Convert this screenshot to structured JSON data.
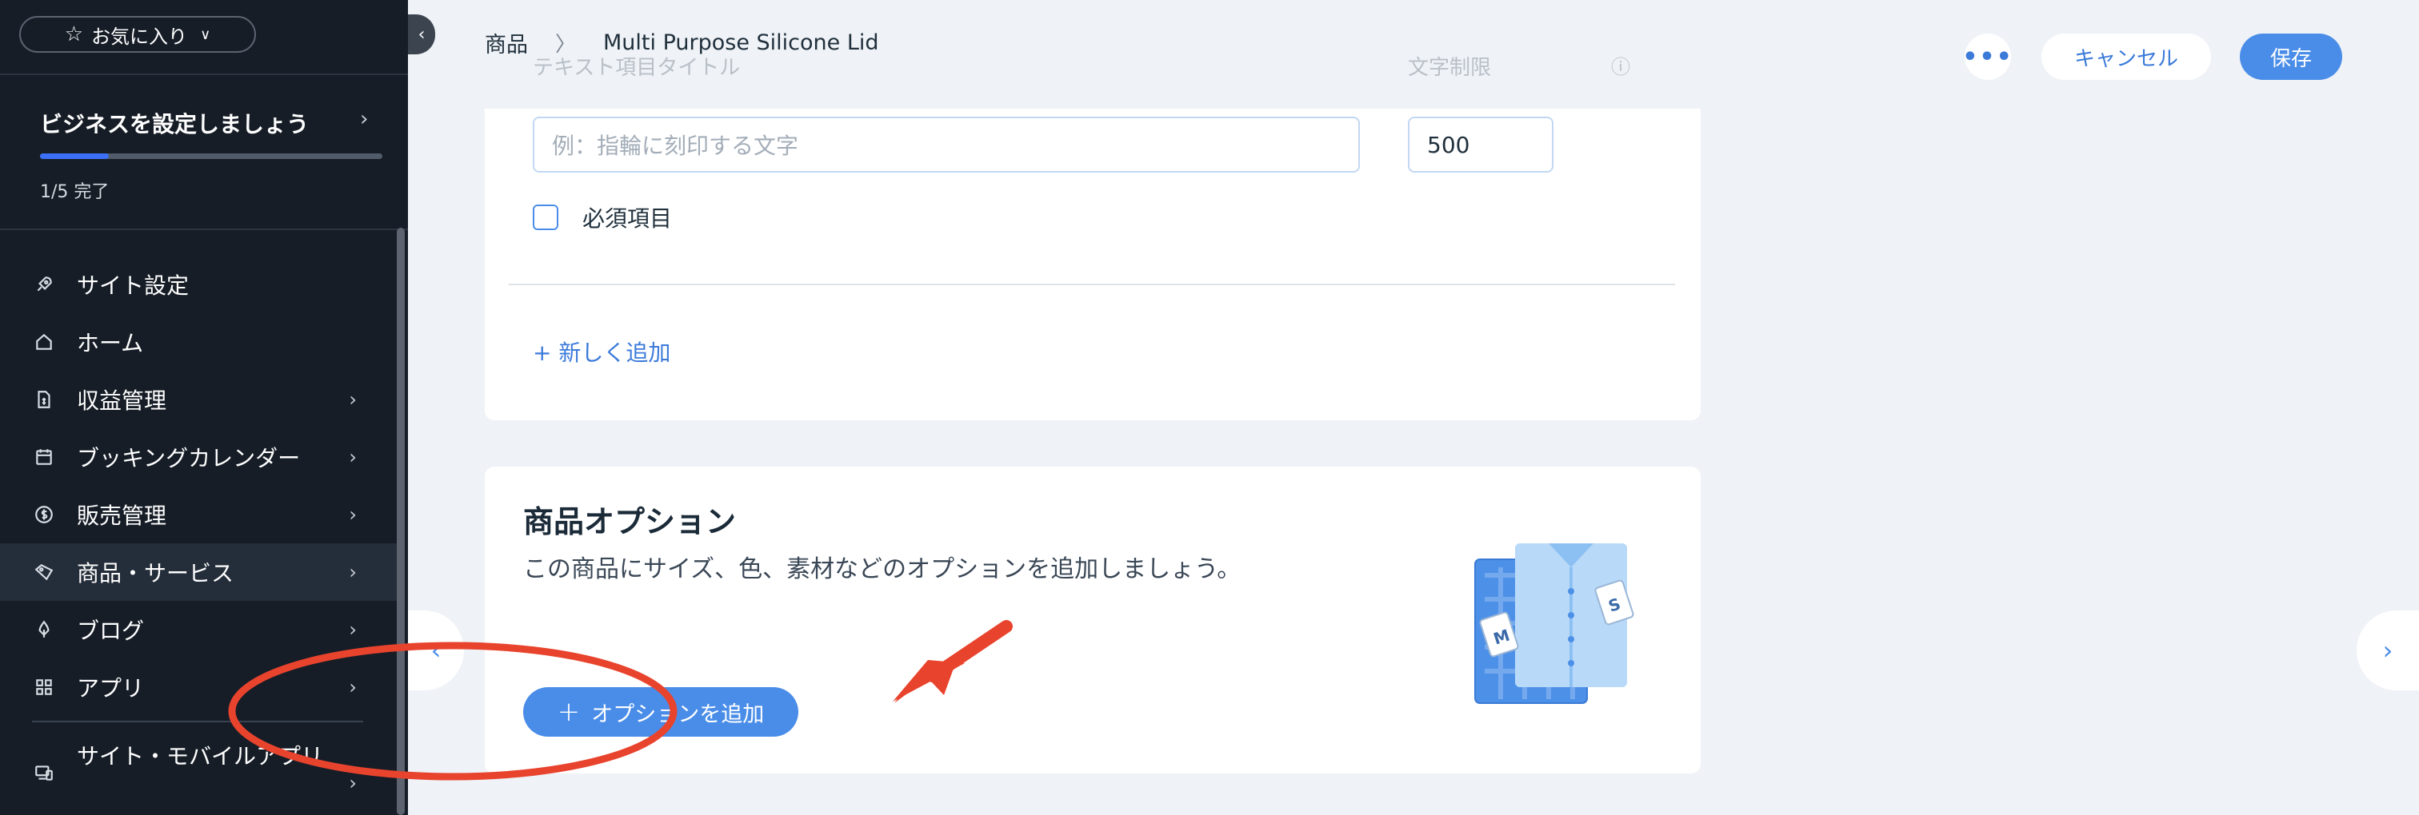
{
  "sidebar": {
    "favorites_label": "お気に入り",
    "setup": {
      "title": "ビジネスを設定しましょう",
      "progress_text": "1/5 完了",
      "progress_fraction": 0.2
    },
    "items": [
      {
        "label": "サイト設定",
        "icon": "rocket-icon",
        "has_arrow": false
      },
      {
        "label": "ホーム",
        "icon": "home-icon",
        "has_arrow": false
      },
      {
        "label": "収益管理",
        "icon": "revenue-icon",
        "has_arrow": true
      },
      {
        "label": "ブッキングカレンダー",
        "icon": "calendar-icon",
        "has_arrow": true
      },
      {
        "label": "販売管理",
        "icon": "dollar-icon",
        "has_arrow": true
      },
      {
        "label": "商品・サービス",
        "icon": "tag-icon",
        "has_arrow": true
      },
      {
        "label": "ブログ",
        "icon": "pen-icon",
        "has_arrow": true
      },
      {
        "label": "アプリ",
        "icon": "apps-icon",
        "has_arrow": true
      }
    ],
    "bottom_item": {
      "label": "サイト・モバイルアプリ",
      "icon": "devices-icon"
    }
  },
  "header": {
    "breadcrumb_root": "商品",
    "breadcrumb_current": "Multi Purpose Silicone Lid",
    "more_label": "•••",
    "cancel_label": "キャンセル",
    "save_label": "保存"
  },
  "custom_text": {
    "field_title_label": "テキスト項目タイトル",
    "char_limit_label": "文字制限",
    "text_placeholder": "例：指輪に刻印する文字",
    "char_limit_value": "500",
    "required_label": "必須項目",
    "add_new_label": "+ 新しく追加"
  },
  "options": {
    "title": "商品オプション",
    "description": "この商品にサイズ、色、素材などのオプションを追加しましょう。",
    "add_button_label": "オプションを追加",
    "tag_m": "M",
    "tag_s": "S"
  },
  "colors": {
    "sidebar_bg": "#161d27",
    "accent": "#4a8de8",
    "annotation_red": "#e8432d"
  }
}
